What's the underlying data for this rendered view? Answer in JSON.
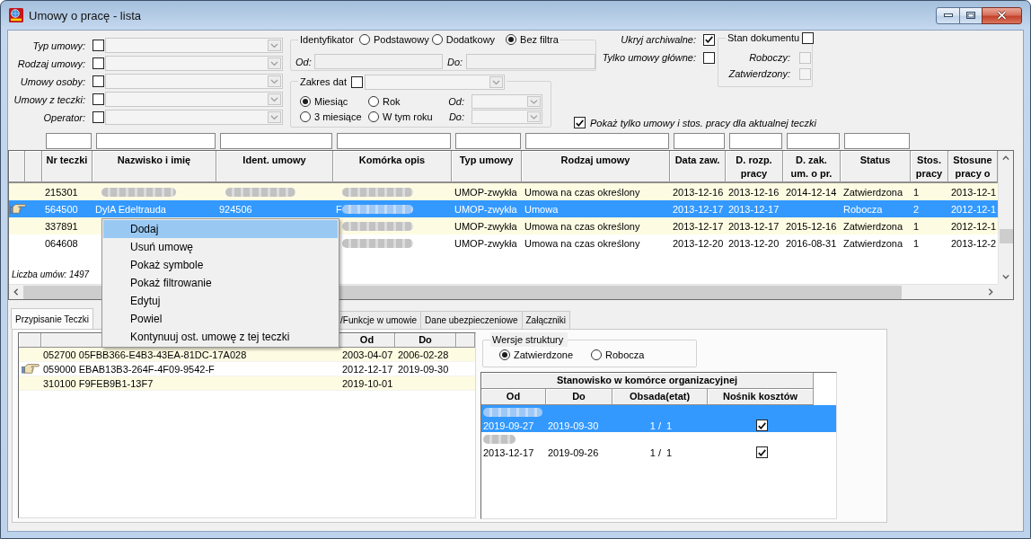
{
  "window": {
    "title": "Umowy o pracę - lista"
  },
  "filters": {
    "rows": [
      {
        "label": "Typ umowy:",
        "checked": false,
        "disabled": true
      },
      {
        "label": "Rodzaj umowy:",
        "checked": false,
        "disabled": true
      },
      {
        "label": "Umowy osoby:",
        "checked": false,
        "disabled": true
      },
      {
        "label": "Umowy z teczki:",
        "checked": false,
        "disabled": true
      },
      {
        "label": "Operator:",
        "checked": false,
        "disabled": true
      }
    ],
    "identifier": {
      "title": "Identyfikator",
      "options": [
        {
          "label": "Podstawowy",
          "selected": false
        },
        {
          "label": "Dodatkowy",
          "selected": false
        },
        {
          "label": "Bez filtra",
          "selected": true
        }
      ],
      "from": {
        "label": "Od:",
        "disabled": true
      },
      "to": {
        "label": "Do:",
        "disabled": true
      }
    },
    "date_range": {
      "title": "Zakres dat",
      "checked": false,
      "disabled": true,
      "options": [
        {
          "label": "Miesiąc",
          "selected": true
        },
        {
          "label": "Rok",
          "selected": false
        },
        {
          "label": "3 miesiące",
          "selected": false
        },
        {
          "label": "W tym roku",
          "selected": false
        }
      ],
      "from": {
        "label": "Od:",
        "disabled": true
      },
      "to": {
        "label": "Do:",
        "disabled": true
      }
    },
    "flags": [
      {
        "label": "Ukryj archiwalne:",
        "checked": true
      },
      {
        "label": "Tylko umowy główne:",
        "checked": false
      }
    ],
    "document_state": {
      "title": "Stan dokumentu",
      "checked": false,
      "options": [
        {
          "label": "Roboczy:",
          "checked": false,
          "disabled": true
        },
        {
          "label": "Zatwierdzony:",
          "checked": false,
          "disabled": true
        }
      ]
    },
    "current_folder_only": {
      "label": "Pokaż tylko umowy i stos. pracy dla aktualnej teczki",
      "checked": true
    }
  },
  "contracts_table": {
    "columns": [
      {
        "lines": [
          "Nr teczki"
        ],
        "filterable": true
      },
      {
        "lines": [
          "Nazwisko i imię"
        ],
        "filterable": true
      },
      {
        "lines": [
          "Ident. umowy"
        ],
        "filterable": true
      },
      {
        "lines": [
          "Komórka opis"
        ],
        "filterable": true
      },
      {
        "lines": [
          "Typ umowy"
        ],
        "filterable": true
      },
      {
        "lines": [
          "Rodzaj umowy"
        ],
        "filterable": true
      },
      {
        "lines": [
          "Data zaw."
        ],
        "filterable": true
      },
      {
        "lines": [
          "D. rozp.",
          "pracy"
        ],
        "filterable": true
      },
      {
        "lines": [
          "D. zak.",
          "um. o pr."
        ],
        "filterable": true
      },
      {
        "lines": [
          "Status"
        ],
        "filterable": true
      },
      {
        "lines": [
          "Stos.",
          "pracy"
        ],
        "filterable": false
      },
      {
        "lines": [
          "Stosune",
          "pracy o"
        ],
        "filterable": false
      }
    ],
    "rows": [
      {
        "selected": false,
        "current": false,
        "cells": [
          {
            "kind": "text",
            "text": "215301"
          },
          {
            "kind": "blurred"
          },
          {
            "kind": "blurred"
          },
          {
            "kind": "blurred"
          },
          {
            "kind": "text",
            "text": "UMOP-zwykła"
          },
          {
            "kind": "text",
            "text": "Umowa na czas określony"
          },
          {
            "kind": "text",
            "text": "2013-12-16"
          },
          {
            "kind": "text",
            "text": "2013-12-16"
          },
          {
            "kind": "text",
            "text": "2014-12-14"
          },
          {
            "kind": "text",
            "text": "Zatwierdzona"
          },
          {
            "kind": "text",
            "text": "1"
          },
          {
            "kind": "text",
            "text": "2013-12-1"
          }
        ]
      },
      {
        "selected": true,
        "current": true,
        "cells": [
          {
            "kind": "text",
            "text": "564500"
          },
          {
            "kind": "text",
            "text": "DylA Edeltrauda"
          },
          {
            "kind": "text",
            "text": "924506"
          },
          {
            "kind": "blurred",
            "text": "F"
          },
          {
            "kind": "text",
            "text": "UMOP-zwykła"
          },
          {
            "kind": "text",
            "text": "Umowa"
          },
          {
            "kind": "text",
            "text": "2013-12-17"
          },
          {
            "kind": "text",
            "text": "2013-12-17"
          },
          {
            "kind": "empty"
          },
          {
            "kind": "text",
            "text": "Robocza"
          },
          {
            "kind": "text",
            "text": "2"
          },
          {
            "kind": "text",
            "text": "2012-12-1"
          }
        ]
      },
      {
        "selected": false,
        "current": false,
        "cells": [
          {
            "kind": "text",
            "text": "337891"
          },
          {
            "kind": "empty"
          },
          {
            "kind": "empty"
          },
          {
            "kind": "blurred"
          },
          {
            "kind": "text",
            "text": "UMOP-zwykła"
          },
          {
            "kind": "text",
            "text": "Umowa na czas określony"
          },
          {
            "kind": "text",
            "text": "2013-12-17"
          },
          {
            "kind": "text",
            "text": "2013-12-17"
          },
          {
            "kind": "text",
            "text": "2015-12-16"
          },
          {
            "kind": "text",
            "text": "Zatwierdzona"
          },
          {
            "kind": "text",
            "text": "1"
          },
          {
            "kind": "text",
            "text": "2012-12-1"
          }
        ]
      },
      {
        "selected": false,
        "current": false,
        "cells": [
          {
            "kind": "text",
            "text": "064608"
          },
          {
            "kind": "empty"
          },
          {
            "kind": "empty"
          },
          {
            "kind": "blurred"
          },
          {
            "kind": "text",
            "text": "UMOP-zwykła"
          },
          {
            "kind": "text",
            "text": "Umowa na czas określony"
          },
          {
            "kind": "text",
            "text": "2013-12-20"
          },
          {
            "kind": "text",
            "text": "2013-12-20"
          },
          {
            "kind": "text",
            "text": "2016-08-31"
          },
          {
            "kind": "text",
            "text": "Zatwierdzona"
          },
          {
            "kind": "text",
            "text": "1"
          },
          {
            "kind": "text",
            "text": "2013-12-2"
          }
        ]
      }
    ],
    "count_label": "Liczba umów: 1497"
  },
  "context_menu": {
    "items": [
      {
        "label": "Dodaj",
        "selected": true
      },
      {
        "label": "Usuń umowę",
        "selected": false
      },
      {
        "label": "Pokaż symbole",
        "selected": false
      },
      {
        "label": "Pokaż filtrowanie",
        "selected": false
      },
      {
        "label": "Edytuj",
        "selected": false
      },
      {
        "label": "Powiel",
        "selected": false
      },
      {
        "label": "Kontynuuj ost. umowę z tej teczki",
        "selected": false
      }
    ]
  },
  "tabs": [
    {
      "label": "Przypisanie Teczki",
      "selected": true
    },
    {
      "label": "/Funkcje w umowie",
      "selected": false
    },
    {
      "label": "Dane ubezpieczeniowe",
      "selected": false
    },
    {
      "label": "Załączniki",
      "selected": false
    }
  ],
  "folder_assignments": {
    "columns": [
      {
        "label": "Od"
      },
      {
        "label": "Do"
      }
    ],
    "rows": [
      {
        "current": false,
        "column_2": "052700 05FBB366-E4B3-43EA-81DC-17A028",
        "from": "2003-04-07",
        "to": "2006-02-28"
      },
      {
        "current": true,
        "column_2": "059000 EBAB13B3-264F-4F09-9542-F",
        "from": "2012-12-17",
        "to": "2019-09-30"
      },
      {
        "current": false,
        "column_2": "310100 F9FEB9B1-13F7",
        "from": "2019-10-01"
      }
    ]
  },
  "structure_versions": {
    "title": "Wersje struktury",
    "options": [
      {
        "label": "Zatwierdzone",
        "selected": true
      },
      {
        "label": "Robocza",
        "selected": false
      }
    ]
  },
  "positions_table": {
    "title": "Stanowisko w komórce organizacyjnej",
    "columns": [
      {
        "label": "Od"
      },
      {
        "label": "Do"
      },
      {
        "label": "Obsada(etat)"
      },
      {
        "label": "Nośnik kosztów"
      }
    ],
    "rows": [
      {
        "selected": true,
        "caption_blurred": true,
        "from": "2019-09-27",
        "to": "2019-09-30",
        "staffing": "1 /  1",
        "cost_carrier": true
      },
      {
        "selected": false,
        "caption_blurred": true,
        "from": "2013-12-17",
        "to": "2019-09-26",
        "staffing": "1 /  1",
        "cost_carrier": true
      }
    ]
  }
}
